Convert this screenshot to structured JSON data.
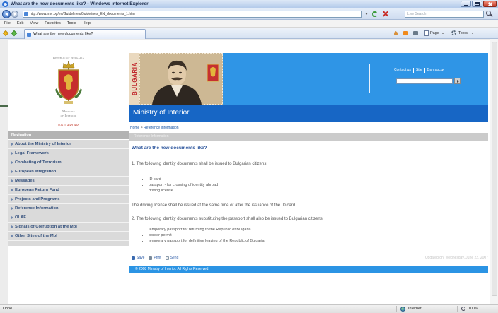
{
  "window": {
    "title": "What are the new documents like? - Windows Internet Explorer"
  },
  "address_bar": {
    "url": "http://www.mvr.bg/en/Guidelines/Guidelines_EN_documents_1.htm",
    "search_placeholder": "Live Search"
  },
  "menu_bar": {
    "items": [
      "File",
      "Edit",
      "View",
      "Favorites",
      "Tools",
      "Help"
    ]
  },
  "tab_bar": {
    "tab_label": "What are the new documents like?",
    "page_label": "Page",
    "tools_label": "Tools"
  },
  "site": {
    "country": "Republic of Bulgaria",
    "ministry_line1": "Ministry",
    "ministry_line2": "of Interior",
    "language_link": "БЪЛГАРСКИ"
  },
  "banner": {
    "stamp_text": "BULGARIA",
    "links": [
      "Contact us",
      "Site",
      "Български"
    ],
    "title": "Ministry of Interior"
  },
  "nav": {
    "header": "Navigation",
    "items": [
      "About the Ministry of Interior",
      "Legal Framework",
      "Combating of Terrorism",
      "European Integration",
      "Messages",
      "European Return Fund",
      "Projects and Programs",
      "Reference Information",
      "OLAF",
      "Signals of Corruption at the MoI",
      "Other Sites of the MoI"
    ]
  },
  "breadcrumb": {
    "home": "Home",
    "separator": ">",
    "current": "Reference Information"
  },
  "section_bar": "Reference Information",
  "article": {
    "heading": "What are the new documents like?",
    "para1": "1. The following identity documents shall be issued to Bulgarian citizens:",
    "list1": [
      "ID card",
      "passport - for crossing of identity abroad",
      "driving license"
    ],
    "para2": "The driving license shall be issued at the same time or after the issuance of the ID card",
    "para3": "2. The following identity documents substituting the passport shall also be issued to Bulgarian citizens:",
    "list2": [
      "temporary passport for returning to the Republic of Bulgaria",
      "border permit",
      "temporary passport for definitive leaving of the Republic of Bulgaria"
    ]
  },
  "page_footer": {
    "actions": [
      "Save",
      "Print",
      "Send"
    ],
    "updated": "Updated on: Wednesday, June 22, 2007",
    "copyright": "© 2008 Ministry of Interior. All Rights Reserved."
  },
  "status_bar": {
    "text": "Done",
    "zone": "Internet",
    "zoom": "100%"
  },
  "colors": {
    "banner_blue": "#2f95e6",
    "title_band_blue": "#1766c5",
    "footer_blue": "#2b94e4",
    "heading_blue": "#27519a",
    "nav_gray": "#dadada",
    "link_red": "#c0392b"
  }
}
